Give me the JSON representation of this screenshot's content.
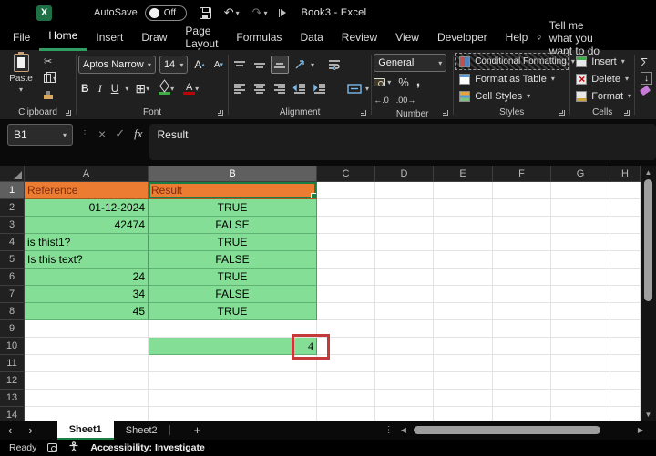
{
  "titlebar": {
    "autosave_label": "AutoSave",
    "autosave_state": "Off",
    "title": "Book3 - Excel"
  },
  "menu": {
    "tabs": [
      "File",
      "Home",
      "Insert",
      "Draw",
      "Page Layout",
      "Formulas",
      "Data",
      "Review",
      "View",
      "Developer",
      "Help"
    ],
    "active_tab": "Home",
    "tell_me": "Tell me what you want to do"
  },
  "ribbon": {
    "clipboard": {
      "label": "Clipboard",
      "paste": "Paste"
    },
    "font": {
      "label": "Font",
      "family": "Aptos Narrow",
      "size": "14",
      "bold": "B",
      "italic": "I",
      "underline": "U"
    },
    "alignment": {
      "label": "Alignment"
    },
    "number": {
      "label": "Number",
      "format": "General"
    },
    "styles": {
      "label": "Styles",
      "conditional": "Conditional Formatting",
      "format_table": "Format as Table",
      "cell_styles": "Cell Styles"
    },
    "cells": {
      "label": "Cells",
      "insert": "Insert",
      "delete": "Delete",
      "format": "Format"
    }
  },
  "formula_bar": {
    "name_box": "B1",
    "content": "Result",
    "fx": "fx"
  },
  "grid": {
    "columns": [
      "A",
      "B",
      "C",
      "D",
      "E",
      "F",
      "G",
      "H"
    ],
    "rows": [
      "1",
      "2",
      "3",
      "4",
      "5",
      "6",
      "7",
      "8",
      "9",
      "10",
      "11",
      "12",
      "13",
      "14"
    ]
  },
  "sheet": {
    "r1": {
      "A": "Reference",
      "B": "Result"
    },
    "r2": {
      "A": "01-12-2024",
      "B": "TRUE"
    },
    "r3": {
      "A": "42474",
      "B": "FALSE"
    },
    "r4": {
      "A": "is thist1?",
      "B": "TRUE"
    },
    "r5": {
      "A": "Is this text?",
      "B": "FALSE"
    },
    "r6": {
      "A": "24",
      "B": "TRUE"
    },
    "r7": {
      "A": "34",
      "B": "FALSE"
    },
    "r8": {
      "A": "45",
      "B": "TRUE"
    },
    "r10": {
      "B": "4"
    }
  },
  "sheet_bar": {
    "tab1": "Sheet1",
    "tab2": "Sheet2"
  },
  "status_bar": {
    "ready": "Ready",
    "accessibility": "Accessibility: Investigate"
  },
  "icons": {
    "excel_logo": "X",
    "undo": "↶",
    "redo": "↷",
    "chevron": "▾",
    "letter_a": "A",
    "scissors": "✂",
    "borders": "⊞",
    "sum": "Σ",
    "percent": "%",
    "comma": ",",
    "increase_decimal": "←.0",
    "decrease_decimal": ".00→",
    "cancel": "×",
    "enter": "✓",
    "dots": "⋮",
    "prev_sheet": "‹",
    "next_sheet": "›",
    "add_sheet": "+",
    "scroll_left": "◀",
    "scroll_right": "▶",
    "scroll_up": "▲",
    "scroll_down": "▼",
    "fill_down": "↓"
  },
  "colors": {
    "accent_green": "#1a7e45",
    "cell_green": "#85DE96",
    "cell_orange": "#EC7C31",
    "annotation_red": "#c43a3a"
  }
}
